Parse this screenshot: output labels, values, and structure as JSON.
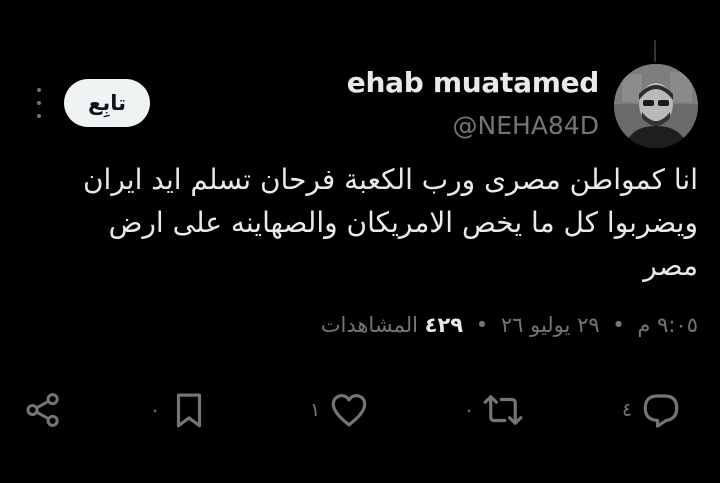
{
  "tweet": {
    "author": {
      "display_name": "ehab muatamed",
      "handle": "@NEHA84D"
    },
    "follow_label": "تابِع",
    "text_lines": [
      "انا كمواطن مصرى ورب الكعبة فرحان تسلم ايد ايران",
      "ويضربوا كل ما يخص الامريكان والصهاينه على ارض",
      "مصر"
    ],
    "time": "٩:٠٥ م",
    "date": "٢٩ يوليو ٢٦",
    "views_count": "٤٢٩",
    "views_label": "المشاهدات",
    "separator": "•"
  },
  "actions": {
    "reply_count": "٤",
    "retweet_count": "٠",
    "like_count": "١",
    "bookmark_count": "٠"
  },
  "colors": {
    "background": "#000000",
    "text": "#e7e9ea",
    "muted": "#71767b",
    "follow_bg": "#eff3f4"
  }
}
